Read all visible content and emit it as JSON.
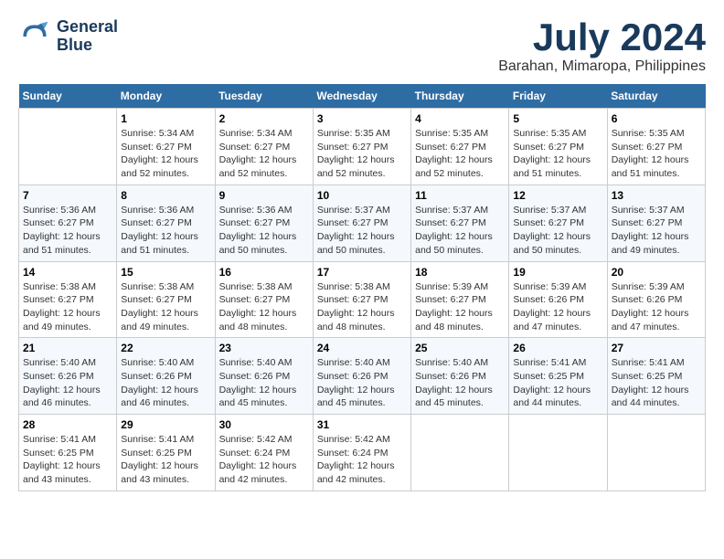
{
  "header": {
    "logo_line1": "General",
    "logo_line2": "Blue",
    "month": "July 2024",
    "location": "Barahan, Mimaropa, Philippines"
  },
  "weekdays": [
    "Sunday",
    "Monday",
    "Tuesday",
    "Wednesday",
    "Thursday",
    "Friday",
    "Saturday"
  ],
  "weeks": [
    [
      {
        "day": "",
        "sunrise": "",
        "sunset": "",
        "daylight": ""
      },
      {
        "day": "1",
        "sunrise": "Sunrise: 5:34 AM",
        "sunset": "Sunset: 6:27 PM",
        "daylight": "Daylight: 12 hours and 52 minutes."
      },
      {
        "day": "2",
        "sunrise": "Sunrise: 5:34 AM",
        "sunset": "Sunset: 6:27 PM",
        "daylight": "Daylight: 12 hours and 52 minutes."
      },
      {
        "day": "3",
        "sunrise": "Sunrise: 5:35 AM",
        "sunset": "Sunset: 6:27 PM",
        "daylight": "Daylight: 12 hours and 52 minutes."
      },
      {
        "day": "4",
        "sunrise": "Sunrise: 5:35 AM",
        "sunset": "Sunset: 6:27 PM",
        "daylight": "Daylight: 12 hours and 52 minutes."
      },
      {
        "day": "5",
        "sunrise": "Sunrise: 5:35 AM",
        "sunset": "Sunset: 6:27 PM",
        "daylight": "Daylight: 12 hours and 51 minutes."
      },
      {
        "day": "6",
        "sunrise": "Sunrise: 5:35 AM",
        "sunset": "Sunset: 6:27 PM",
        "daylight": "Daylight: 12 hours and 51 minutes."
      }
    ],
    [
      {
        "day": "7",
        "sunrise": "Sunrise: 5:36 AM",
        "sunset": "Sunset: 6:27 PM",
        "daylight": "Daylight: 12 hours and 51 minutes."
      },
      {
        "day": "8",
        "sunrise": "Sunrise: 5:36 AM",
        "sunset": "Sunset: 6:27 PM",
        "daylight": "Daylight: 12 hours and 51 minutes."
      },
      {
        "day": "9",
        "sunrise": "Sunrise: 5:36 AM",
        "sunset": "Sunset: 6:27 PM",
        "daylight": "Daylight: 12 hours and 50 minutes."
      },
      {
        "day": "10",
        "sunrise": "Sunrise: 5:37 AM",
        "sunset": "Sunset: 6:27 PM",
        "daylight": "Daylight: 12 hours and 50 minutes."
      },
      {
        "day": "11",
        "sunrise": "Sunrise: 5:37 AM",
        "sunset": "Sunset: 6:27 PM",
        "daylight": "Daylight: 12 hours and 50 minutes."
      },
      {
        "day": "12",
        "sunrise": "Sunrise: 5:37 AM",
        "sunset": "Sunset: 6:27 PM",
        "daylight": "Daylight: 12 hours and 50 minutes."
      },
      {
        "day": "13",
        "sunrise": "Sunrise: 5:37 AM",
        "sunset": "Sunset: 6:27 PM",
        "daylight": "Daylight: 12 hours and 49 minutes."
      }
    ],
    [
      {
        "day": "14",
        "sunrise": "Sunrise: 5:38 AM",
        "sunset": "Sunset: 6:27 PM",
        "daylight": "Daylight: 12 hours and 49 minutes."
      },
      {
        "day": "15",
        "sunrise": "Sunrise: 5:38 AM",
        "sunset": "Sunset: 6:27 PM",
        "daylight": "Daylight: 12 hours and 49 minutes."
      },
      {
        "day": "16",
        "sunrise": "Sunrise: 5:38 AM",
        "sunset": "Sunset: 6:27 PM",
        "daylight": "Daylight: 12 hours and 48 minutes."
      },
      {
        "day": "17",
        "sunrise": "Sunrise: 5:38 AM",
        "sunset": "Sunset: 6:27 PM",
        "daylight": "Daylight: 12 hours and 48 minutes."
      },
      {
        "day": "18",
        "sunrise": "Sunrise: 5:39 AM",
        "sunset": "Sunset: 6:27 PM",
        "daylight": "Daylight: 12 hours and 48 minutes."
      },
      {
        "day": "19",
        "sunrise": "Sunrise: 5:39 AM",
        "sunset": "Sunset: 6:26 PM",
        "daylight": "Daylight: 12 hours and 47 minutes."
      },
      {
        "day": "20",
        "sunrise": "Sunrise: 5:39 AM",
        "sunset": "Sunset: 6:26 PM",
        "daylight": "Daylight: 12 hours and 47 minutes."
      }
    ],
    [
      {
        "day": "21",
        "sunrise": "Sunrise: 5:40 AM",
        "sunset": "Sunset: 6:26 PM",
        "daylight": "Daylight: 12 hours and 46 minutes."
      },
      {
        "day": "22",
        "sunrise": "Sunrise: 5:40 AM",
        "sunset": "Sunset: 6:26 PM",
        "daylight": "Daylight: 12 hours and 46 minutes."
      },
      {
        "day": "23",
        "sunrise": "Sunrise: 5:40 AM",
        "sunset": "Sunset: 6:26 PM",
        "daylight": "Daylight: 12 hours and 45 minutes."
      },
      {
        "day": "24",
        "sunrise": "Sunrise: 5:40 AM",
        "sunset": "Sunset: 6:26 PM",
        "daylight": "Daylight: 12 hours and 45 minutes."
      },
      {
        "day": "25",
        "sunrise": "Sunrise: 5:40 AM",
        "sunset": "Sunset: 6:26 PM",
        "daylight": "Daylight: 12 hours and 45 minutes."
      },
      {
        "day": "26",
        "sunrise": "Sunrise: 5:41 AM",
        "sunset": "Sunset: 6:25 PM",
        "daylight": "Daylight: 12 hours and 44 minutes."
      },
      {
        "day": "27",
        "sunrise": "Sunrise: 5:41 AM",
        "sunset": "Sunset: 6:25 PM",
        "daylight": "Daylight: 12 hours and 44 minutes."
      }
    ],
    [
      {
        "day": "28",
        "sunrise": "Sunrise: 5:41 AM",
        "sunset": "Sunset: 6:25 PM",
        "daylight": "Daylight: 12 hours and 43 minutes."
      },
      {
        "day": "29",
        "sunrise": "Sunrise: 5:41 AM",
        "sunset": "Sunset: 6:25 PM",
        "daylight": "Daylight: 12 hours and 43 minutes."
      },
      {
        "day": "30",
        "sunrise": "Sunrise: 5:42 AM",
        "sunset": "Sunset: 6:24 PM",
        "daylight": "Daylight: 12 hours and 42 minutes."
      },
      {
        "day": "31",
        "sunrise": "Sunrise: 5:42 AM",
        "sunset": "Sunset: 6:24 PM",
        "daylight": "Daylight: 12 hours and 42 minutes."
      },
      {
        "day": "",
        "sunrise": "",
        "sunset": "",
        "daylight": ""
      },
      {
        "day": "",
        "sunrise": "",
        "sunset": "",
        "daylight": ""
      },
      {
        "day": "",
        "sunrise": "",
        "sunset": "",
        "daylight": ""
      }
    ]
  ]
}
